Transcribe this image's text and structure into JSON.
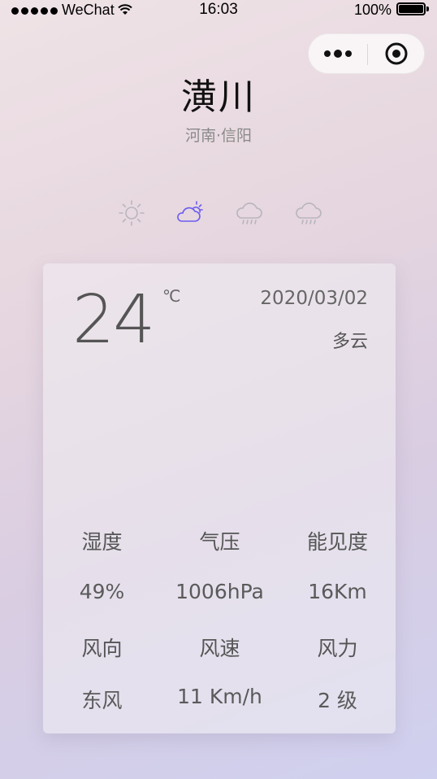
{
  "status_bar": {
    "carrier": "WeChat",
    "time": "16:03",
    "battery": "100%"
  },
  "location": {
    "city": "潢川",
    "region": "河南·信阳"
  },
  "forecast_icons": [
    {
      "icon": "sun-icon",
      "active": false
    },
    {
      "icon": "partly-cloudy-icon",
      "active": true
    },
    {
      "icon": "rain-cloud-icon",
      "active": false
    },
    {
      "icon": "rain-cloud-icon",
      "active": false
    }
  ],
  "colors": {
    "active_icon": "#6b5cf0",
    "inactive_icon": "#b8b5bd"
  },
  "current": {
    "temperature": "24",
    "unit": "℃",
    "date": "2020/03/02",
    "condition": "多云"
  },
  "details": {
    "humidity_label": "湿度",
    "pressure_label": "气压",
    "visibility_label": "能见度",
    "humidity": "49%",
    "pressure": "1006hPa",
    "visibility": "16Km",
    "wind_dir_label": "风向",
    "wind_speed_label": "风速",
    "wind_power_label": "风力",
    "wind_dir": "东风",
    "wind_speed": "11 Km/h",
    "wind_power": "2 级"
  }
}
